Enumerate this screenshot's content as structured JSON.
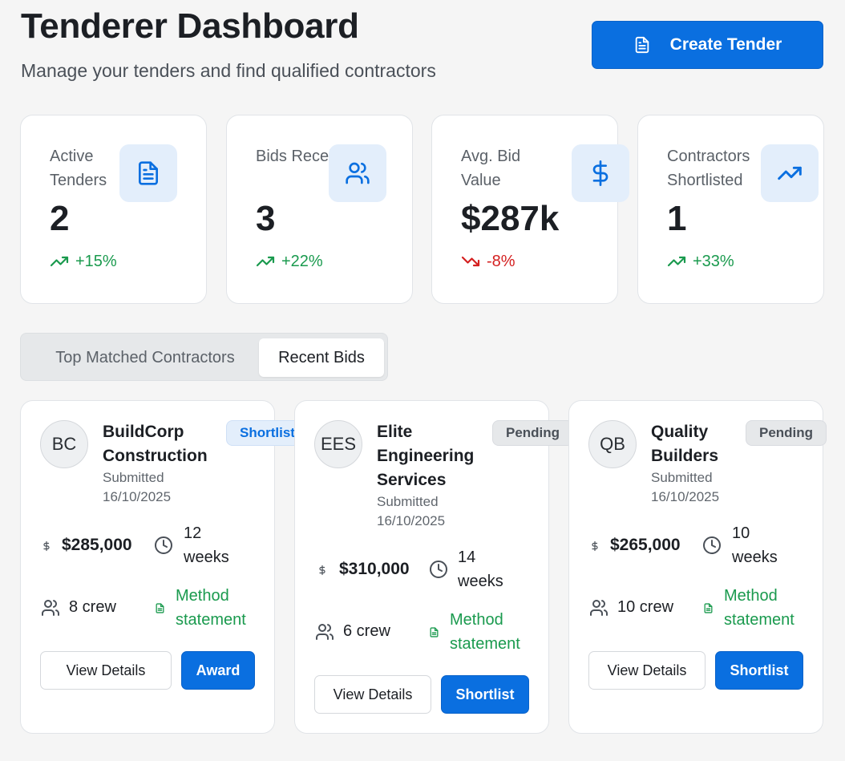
{
  "header": {
    "title": "Tenderer Dashboard",
    "subtitle": "Manage your tenders and find qualified contractors",
    "create_button": "Create Tender"
  },
  "stats": [
    {
      "label": "Active Tenders",
      "value": "2",
      "trend": "+15%",
      "direction": "up",
      "icon": "document-icon"
    },
    {
      "label": "Bids Received",
      "value": "3",
      "trend": "+22%",
      "direction": "up",
      "icon": "users-icon"
    },
    {
      "label": "Avg. Bid Value",
      "value": "$287k",
      "trend": "-8%",
      "direction": "down",
      "icon": "dollar-icon"
    },
    {
      "label": "Contractors Shortlisted",
      "value": "1",
      "trend": "+33%",
      "direction": "up",
      "icon": "trending-up-icon"
    }
  ],
  "tabs": [
    {
      "label": "Top Matched Contractors",
      "active": false
    },
    {
      "label": "Recent Bids",
      "active": true
    }
  ],
  "bids": [
    {
      "initials": "BC",
      "name": "BuildCorp Construction",
      "submitted": "Submitted 16/10/2025",
      "status": "Shortlisted",
      "amount": "$285,000",
      "duration": "12 weeks",
      "crew": "8 crew",
      "method": "Method statement",
      "secondary_action": "View Details",
      "primary_action": "Award"
    },
    {
      "initials": "EES",
      "name": "Elite Engineering Services",
      "submitted": "Submitted 16/10/2025",
      "status": "Pending",
      "amount": "$310,000",
      "duration": "14 weeks",
      "crew": "6 crew",
      "method": "Method statement",
      "secondary_action": "View Details",
      "primary_action": "Shortlist"
    },
    {
      "initials": "QB",
      "name": "Quality Builders",
      "submitted": "Submitted 16/10/2025",
      "status": "Pending",
      "amount": "$265,000",
      "duration": "10 weeks",
      "crew": "10 crew",
      "method": "Method statement",
      "secondary_action": "View Details",
      "primary_action": "Shortlist"
    }
  ],
  "colors": {
    "accent": "#0a6fe0",
    "trend_up": "#1a9a4e",
    "trend_down": "#d42020",
    "icon_tile": "#e3eefb"
  }
}
